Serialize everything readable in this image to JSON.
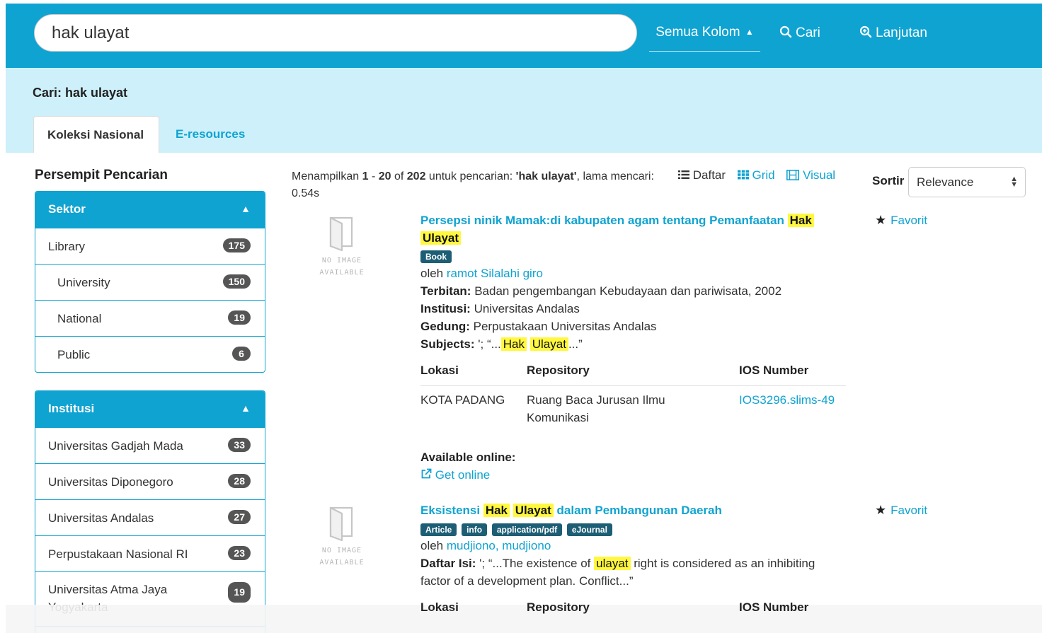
{
  "search": {
    "query": "hak ulayat",
    "column_label": "Semua Kolom",
    "cari_label": "Cari",
    "lanjutan_label": "Lanjutan"
  },
  "band": {
    "title": "Cari: hak ulayat",
    "tabs": [
      {
        "label": "Koleksi Nasional"
      },
      {
        "label": "E-resources"
      }
    ]
  },
  "sidebar": {
    "title": "Persempit Pencarian",
    "facets": [
      {
        "label": "Sektor",
        "items": [
          {
            "label": "Library",
            "count": "175"
          },
          {
            "label": "University",
            "count": "150"
          },
          {
            "label": "National",
            "count": "19"
          },
          {
            "label": "Public",
            "count": "6"
          }
        ]
      },
      {
        "label": "Institusi",
        "items": [
          {
            "label": "Universitas Gadjah Mada",
            "count": "33"
          },
          {
            "label": "Universitas Diponegoro",
            "count": "28"
          },
          {
            "label": "Universitas Andalas",
            "count": "27"
          },
          {
            "label": "Perpustakaan Nasional RI",
            "count": "23"
          },
          {
            "label": "Universitas Atma Jaya Yogyakarta",
            "count": "19"
          }
        ]
      }
    ]
  },
  "results": {
    "prefix": "Menampilkan ",
    "from": "1",
    "dash": " - ",
    "to": "20",
    "of_text": " of ",
    "total": "202",
    "search_text": " untuk pencarian: ",
    "query_quoted": "'hak ulayat'",
    "time_text": ", lama mencari: 0.54s",
    "views": {
      "list": "Daftar",
      "grid": "Grid",
      "visual": "Visual"
    },
    "sort_label": "Sortir",
    "sort_value": "Relevance",
    "no_image_1": "NO IMAGE",
    "no_image_2": "AVAILABLE",
    "favorit": "Favorit",
    "by": "oleh ",
    "col_lokasi": "Lokasi",
    "col_repository": "Repository",
    "col_ios": "IOS Number"
  },
  "records": [
    {
      "title_a": "Persepsi ninik Mamak:di kabupaten agam tentang Pemanfaatan ",
      "title_hl1": "Hak",
      "title_hl2": "Ulayat",
      "tags": [
        "Book"
      ],
      "author": "ramot Silalahi giro",
      "terbitan_label": "Terbitan:",
      "terbitan": " Badan pengembangan Kebudayaan dan pariwisata, 2002",
      "institusi_label": "Institusi:",
      "institusi": " Universitas Andalas",
      "gedung_label": "Gedung:",
      "gedung": " Perpustakaan Universitas Andalas",
      "subjects_label": "Subjects:",
      "subjects_pre": " '; “...",
      "subjects_hl1": "Hak",
      "subjects_hl2": "Ulayat",
      "subjects_post": "...”",
      "lokasi": "KOTA PADANG",
      "repository": "Ruang Baca Jurusan Ilmu Komunikasi",
      "ios": "IOS3296.slims-49",
      "online_label": "Available online:",
      "online_link": "Get online"
    },
    {
      "title_a": "Eksistensi ",
      "title_hl1": "Hak",
      "title_hl2": "Ulayat",
      "title_b": " dalam Pembangunan Daerah",
      "tags": [
        "Article",
        "info",
        "application/pdf",
        "eJournal"
      ],
      "author": "mudjiono, mudjiono",
      "daftar_label": "Daftar Isi:",
      "daftar_pre": " '; “...The existence of ",
      "daftar_hl": "ulayat",
      "daftar_post": " right is considered as an inhibiting factor of a development plan. Conflict...”"
    }
  ]
}
